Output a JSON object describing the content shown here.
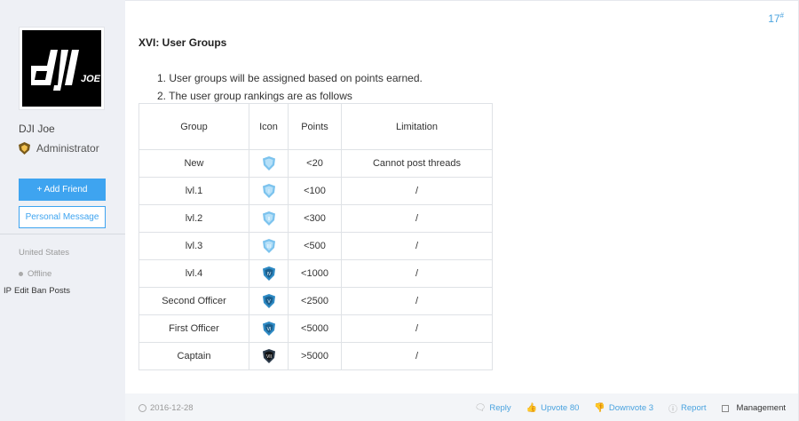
{
  "user": {
    "avatar_logo_text": "dji JOE",
    "name": "DJI Joe",
    "role": "Administrator",
    "add_friend": "+ Add Friend",
    "personal_message": "Personal Message",
    "country": "United States",
    "status": "Offline",
    "admin_links": [
      "IP",
      "Edit",
      "Ban",
      "Posts"
    ]
  },
  "post": {
    "floor_number": "17",
    "floor_suffix": "#",
    "heading": "XVI: User Groups",
    "list": [
      "1. User groups will be assigned based on points earned.",
      "2. The user group rankings are as follows"
    ],
    "table": {
      "headers": [
        "Group",
        "Icon",
        "Points",
        "Limitation"
      ],
      "rows": [
        {
          "group": "New",
          "icon": "shield-rank-new-icon",
          "points": "<20",
          "limitation": "Cannot post threads"
        },
        {
          "group": "lvl.1",
          "icon": "shield-rank-1-icon",
          "points": "<100",
          "limitation": "/"
        },
        {
          "group": "lvl.2",
          "icon": "shield-rank-2-icon",
          "points": "<300",
          "limitation": "/"
        },
        {
          "group": "lvl.3",
          "icon": "shield-rank-3-icon",
          "points": "<500",
          "limitation": "/"
        },
        {
          "group": "lvl.4",
          "icon": "shield-rank-4-icon",
          "points": "<1000",
          "limitation": "/"
        },
        {
          "group": "Second Officer",
          "icon": "shield-rank-5-icon",
          "points": "<2500",
          "limitation": "/"
        },
        {
          "group": "First Officer",
          "icon": "shield-rank-6-icon",
          "points": "<5000",
          "limitation": "/"
        },
        {
          "group": "Captain",
          "icon": "shield-rank-7-icon",
          "points": ">5000",
          "limitation": "/"
        }
      ]
    }
  },
  "footer": {
    "date": "2016-12-28",
    "reply": "Reply",
    "upvote": "Upvote 80",
    "downvote": "Downvote 3",
    "report": "Report",
    "management": "Management"
  },
  "colors": {
    "accent": "#3ea4f0",
    "sidebar_bg": "#eef0f5",
    "footer_bg": "#f3f5f8"
  }
}
